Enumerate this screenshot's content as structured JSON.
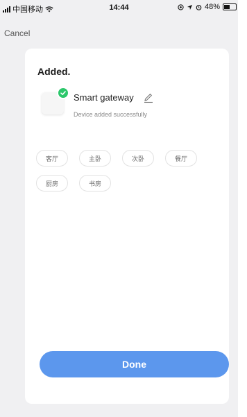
{
  "status_bar": {
    "carrier": "中国移动",
    "time": "14:44",
    "battery_percent": "48%",
    "icons": [
      "signal-icon",
      "wifi-icon",
      "location-icon",
      "navigation-arrow-icon",
      "alarm-icon",
      "battery-icon"
    ]
  },
  "nav": {
    "cancel_label": "Cancel"
  },
  "card": {
    "title": "Added.",
    "device": {
      "name": "Smart gateway",
      "status": "Device added successfully"
    },
    "rooms": [
      "客厅",
      "主卧",
      "次卧",
      "餐厅",
      "厨房",
      "书房"
    ],
    "done_label": "Done"
  },
  "colors": {
    "accent": "#5c97ed",
    "success": "#2cc76b",
    "background": "#f0f0f2"
  }
}
